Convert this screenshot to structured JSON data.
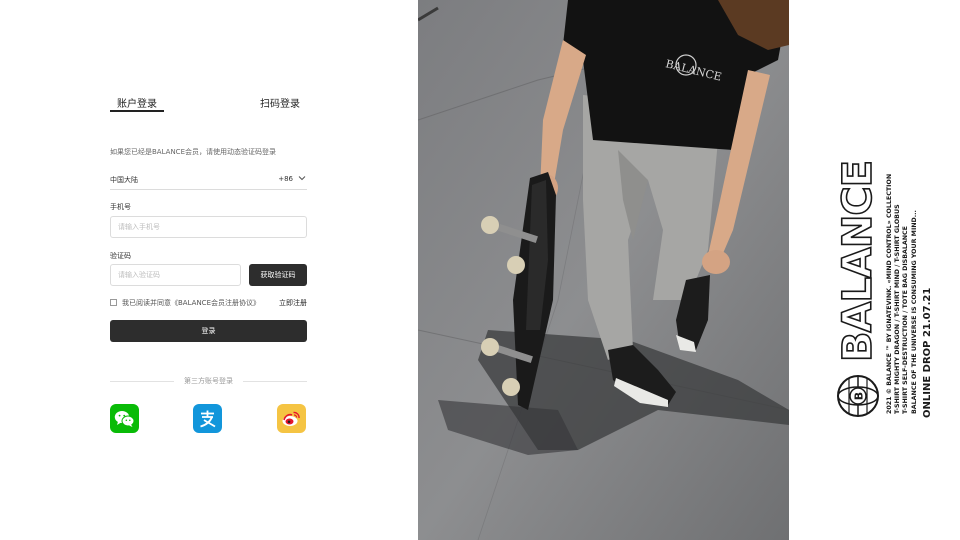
{
  "login": {
    "tab_account": "账户登录",
    "tab_qr": "扫码登录",
    "hint": "如果您已经是BALANCE会员，请使用动态验证码登录",
    "region": {
      "name": "中国大陆",
      "code": "+86"
    },
    "phone_label": "手机号",
    "phone_placeholder": "请输入手机号",
    "code_label": "验证码",
    "code_placeholder": "请输入验证码",
    "get_code_button": "获取验证码",
    "agree_text": "我已阅读并同意《BALANCE会员注册协议》",
    "register_link": "立即注册",
    "login_button": "登录",
    "third_party_label": "第三方账号登录",
    "social": [
      {
        "name": "wechat",
        "icon": "wechat-icon",
        "color": "#09bb07"
      },
      {
        "name": "alipay",
        "icon": "alipay-icon",
        "color": "#1296db"
      },
      {
        "name": "weibo",
        "icon": "weibo-icon",
        "color": "#f5c443"
      }
    ]
  },
  "brand": {
    "wordmark": "BALANCE",
    "drop": "ONLINE DROP 21.07.21",
    "credits": [
      "2021 © BALANCE ™ BY IGNATEVINK. «MIND CONTROL» COLLECTION",
      "T-SHIRT MIGHTY DRAGON / T-SHIRT MIND / T-SHIRT GLOBUS",
      "T-SHIRT SELF-DESTRUCTION / TOTE BAG DISBALANCE",
      "BALANCE OF THE UNIVERSE IS CONSUMING YOUR MIND..."
    ],
    "shirt_print": "BALANCE"
  },
  "colors": {
    "primary_button": "#2d2d2d",
    "text": "#222222",
    "border": "#dcdcdc"
  }
}
